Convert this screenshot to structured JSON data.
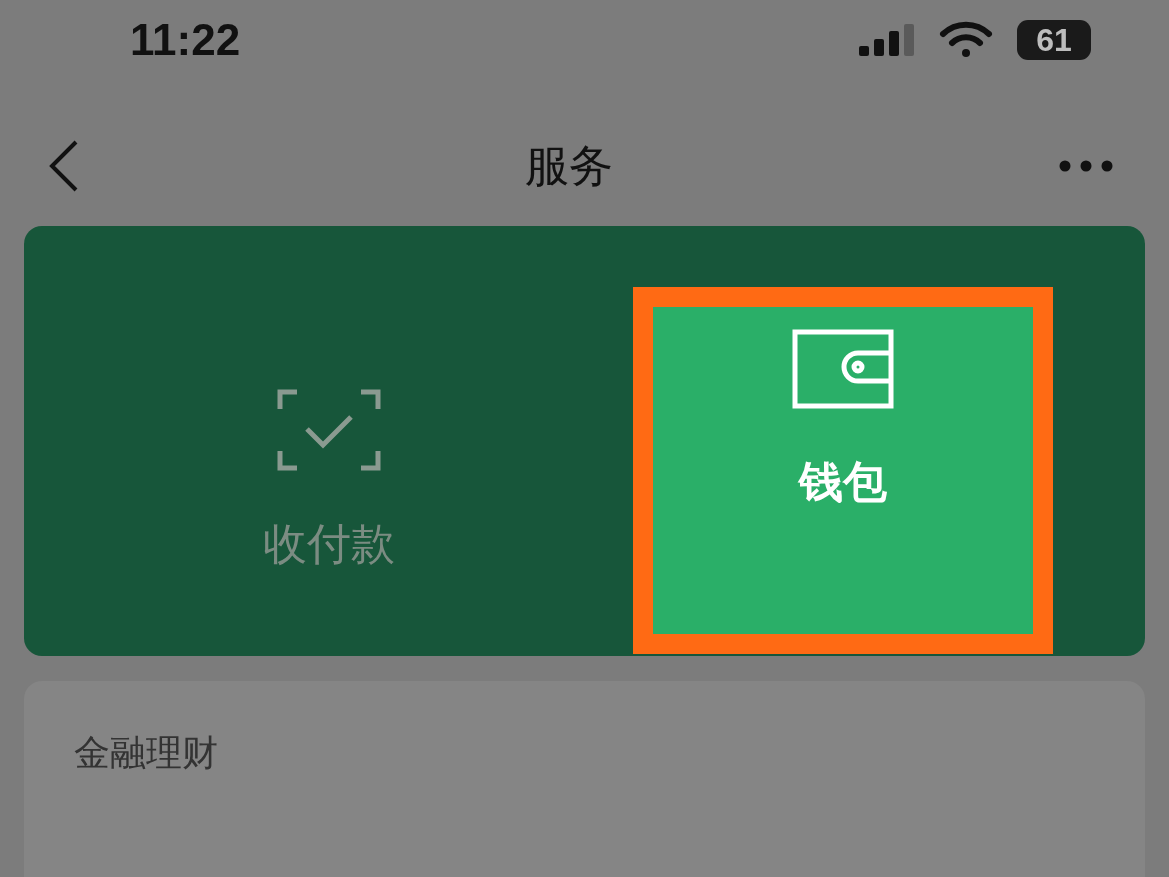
{
  "status_bar": {
    "time": "11:22",
    "battery": "61"
  },
  "nav": {
    "title": "服务"
  },
  "services": [
    {
      "label": "收付款",
      "kind": "scan",
      "selected": false
    },
    {
      "label": "钱包",
      "kind": "wallet",
      "selected": true
    }
  ],
  "sections": [
    {
      "title": "金融理财"
    }
  ]
}
